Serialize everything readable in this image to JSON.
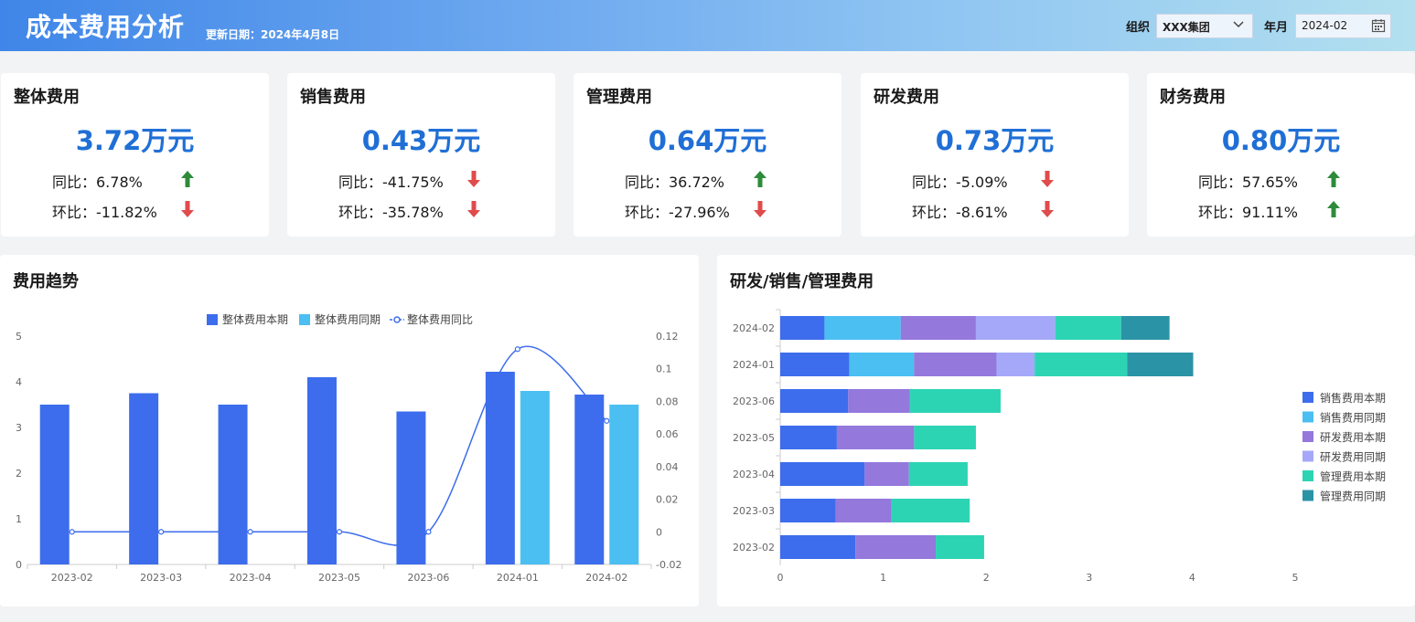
{
  "header": {
    "title": "成本费用分析",
    "update_text": "更新日期：2024年4月8日",
    "org_label": "组织",
    "org_value": "XXX集团",
    "month_label": "年月",
    "month_value": "2024-02"
  },
  "colors": {
    "accent": "#1f6fd6",
    "up": "#2e8b3a",
    "down": "#e04b4b"
  },
  "kpis": [
    {
      "title": "整体费用",
      "value": "3.72万元",
      "yoy": "同比：6.78%",
      "yoy_dir": "up",
      "mom": "环比：-11.82%",
      "mom_dir": "down"
    },
    {
      "title": "销售费用",
      "value": "0.43万元",
      "yoy": "同比：-41.75%",
      "yoy_dir": "down",
      "mom": "环比：-35.78%",
      "mom_dir": "down"
    },
    {
      "title": "管理费用",
      "value": "0.64万元",
      "yoy": "同比：36.72%",
      "yoy_dir": "up",
      "mom": "环比：-27.96%",
      "mom_dir": "down"
    },
    {
      "title": "研发费用",
      "value": "0.73万元",
      "yoy": "同比：-5.09%",
      "yoy_dir": "down",
      "mom": "环比：-8.61%",
      "mom_dir": "down"
    },
    {
      "title": "财务费用",
      "value": "0.80万元",
      "yoy": "同比：57.65%",
      "yoy_dir": "up",
      "mom": "环比：91.11%",
      "mom_dir": "up"
    }
  ],
  "trend_panel": {
    "title": "费用趋势"
  },
  "stack_panel": {
    "title": "研发/销售/管理费用"
  },
  "chart_data": [
    {
      "type": "bar",
      "categories": [
        "2023-02",
        "2023-03",
        "2023-04",
        "2023-05",
        "2023-06",
        "2024-01",
        "2024-02"
      ],
      "series": [
        {
          "name": "整体费用本期",
          "kind": "bar",
          "color": "#3d6ded",
          "values": [
            3.5,
            3.75,
            3.5,
            4.1,
            3.35,
            4.22,
            3.72
          ]
        },
        {
          "name": "整体费用同期",
          "kind": "bar",
          "color": "#4bbff2",
          "values": [
            null,
            null,
            null,
            null,
            null,
            3.8,
            3.5
          ]
        },
        {
          "name": "整体费用同比",
          "kind": "line",
          "color": "#3d6ded",
          "axis": "right",
          "values": [
            0,
            0,
            0,
            0,
            0,
            0.112,
            0.068
          ]
        }
      ],
      "ylim": [
        0,
        5
      ],
      "yticks": [
        0,
        1,
        2,
        3,
        4,
        5
      ],
      "y2lim": [
        -0.02,
        0.12
      ],
      "y2ticks": [
        -0.02,
        0,
        0.02,
        0.04,
        0.06,
        0.08,
        0.1,
        0.12
      ],
      "legend": "top-center",
      "grid": false
    },
    {
      "type": "bar",
      "orientation": "horizontal",
      "stacked": true,
      "categories": [
        "2024-02",
        "2024-01",
        "2023-06",
        "2023-05",
        "2023-04",
        "2023-03",
        "2023-02"
      ],
      "series": [
        {
          "name": "销售费用本期",
          "color": "#3d6ded",
          "values": [
            0.43,
            0.67,
            0.66,
            0.55,
            0.82,
            0.54,
            0.73
          ]
        },
        {
          "name": "销售费用同期",
          "color": "#4bbff2",
          "values": [
            0.74,
            0.63,
            0,
            0,
            0,
            0,
            0
          ]
        },
        {
          "name": "研发费用本期",
          "color": "#9478dc",
          "values": [
            0.73,
            0.8,
            0.6,
            0.75,
            0.43,
            0.54,
            0.78
          ]
        },
        {
          "name": "研发费用同期",
          "color": "#a5a8f9",
          "values": [
            0.77,
            0.37,
            0,
            0,
            0,
            0,
            0
          ]
        },
        {
          "name": "管理费用本期",
          "color": "#2dd4b4",
          "values": [
            0.64,
            0.9,
            0.88,
            0.6,
            0.57,
            0.76,
            0.47
          ]
        },
        {
          "name": "管理费用同期",
          "color": "#2b93a6",
          "values": [
            0.47,
            0.64,
            0,
            0,
            0,
            0,
            0
          ]
        }
      ],
      "xlim": [
        0,
        5
      ],
      "xticks": [
        0,
        1,
        2,
        3,
        4,
        5
      ],
      "legend": "right",
      "grid": false
    }
  ]
}
